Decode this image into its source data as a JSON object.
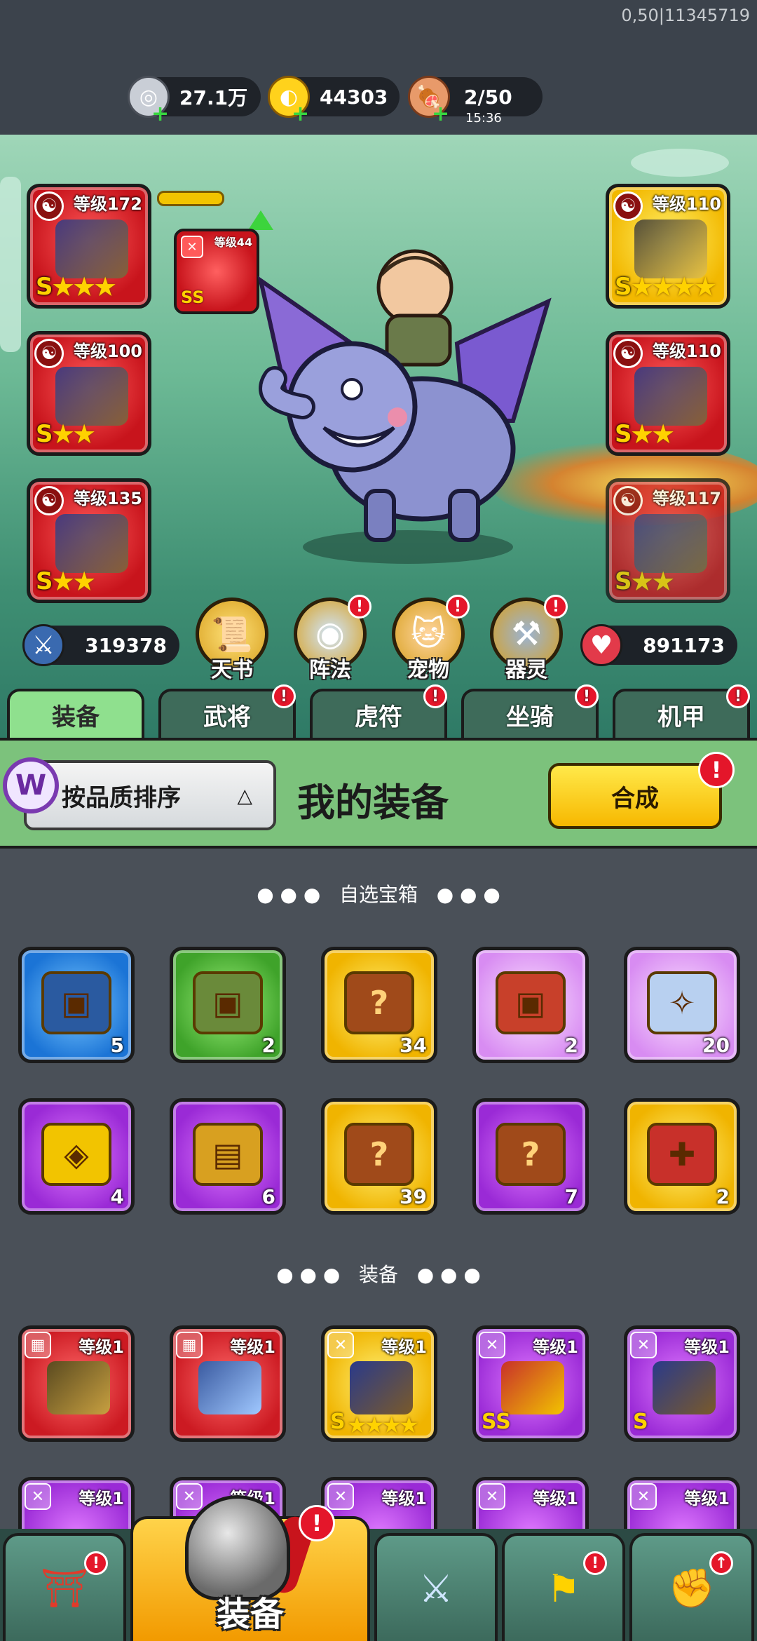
{
  "version": "0,50|11345719",
  "resources": {
    "silver": "27.1万",
    "gold": "44303",
    "stamina": "2/50",
    "stamina_timer": "15:36"
  },
  "hero": {
    "left_slots": [
      {
        "level": "等级172",
        "grade": "S",
        "stars": "★★★",
        "color": "#cc1a22"
      },
      {
        "level": "等级100",
        "grade": "S",
        "stars": "★★",
        "color": "#cc1a22"
      },
      {
        "level": "等级135",
        "grade": "S",
        "stars": "★★",
        "color": "#cc1a22"
      }
    ],
    "right_slots": [
      {
        "level": "等级110",
        "grade": "S",
        "stars": "★★★★",
        "color": "#f2b800"
      },
      {
        "level": "等级110",
        "grade": "S",
        "stars": "★★",
        "color": "#cc1a22"
      },
      {
        "level": "等级117",
        "grade": "S",
        "stars": "★★",
        "color": "#cc1a22"
      }
    ],
    "small_slot": {
      "level": "等级44",
      "grade": "SS",
      "stars": "★"
    },
    "attack": "319378",
    "hp": "891173"
  },
  "features": [
    {
      "label": "天书",
      "icon": "book-icon",
      "badge": false
    },
    {
      "label": "阵法",
      "icon": "formation-icon",
      "badge": true
    },
    {
      "label": "宠物",
      "icon": "pet-cat-icon",
      "badge": true
    },
    {
      "label": "器灵",
      "icon": "spirit-icon",
      "badge": true
    }
  ],
  "tabs": [
    {
      "label": "装备",
      "active": true,
      "badge": false
    },
    {
      "label": "武将",
      "active": false,
      "badge": true
    },
    {
      "label": "虎符",
      "active": false,
      "badge": true
    },
    {
      "label": "坐骑",
      "active": false,
      "badge": true
    },
    {
      "label": "机甲",
      "active": false,
      "badge": true
    }
  ],
  "toolbar": {
    "sort_label": "按品质排序",
    "title": "我的装备",
    "compose_label": "合成",
    "badge": "!"
  },
  "chest_section": {
    "title": "自选宝箱",
    "items": [
      {
        "count": "5",
        "color": "blue"
      },
      {
        "count": "2",
        "color": "green"
      },
      {
        "count": "34",
        "color": "gold"
      },
      {
        "count": "2",
        "color": "pink"
      },
      {
        "count": "20",
        "color": "pink"
      },
      {
        "count": "4",
        "color": "purple"
      },
      {
        "count": "6",
        "color": "purple"
      },
      {
        "count": "39",
        "color": "gold"
      },
      {
        "count": "7",
        "color": "purple"
      },
      {
        "count": "2",
        "color": "gold"
      }
    ]
  },
  "equip_section": {
    "title": "装备",
    "items": [
      {
        "level": "等级1",
        "color": "red",
        "grade": "",
        "stars": ""
      },
      {
        "level": "等级1",
        "color": "red",
        "grade": "",
        "stars": ""
      },
      {
        "level": "等级1",
        "color": "gold",
        "grade": "S",
        "stars": "★★★★"
      },
      {
        "level": "等级1",
        "color": "purple",
        "grade": "SS",
        "stars": ""
      },
      {
        "level": "等级1",
        "color": "purple",
        "grade": "S",
        "stars": ""
      },
      {
        "level": "等级1",
        "color": "purple",
        "grade": "",
        "stars": ""
      },
      {
        "level": "等级1",
        "color": "purple",
        "grade": "",
        "stars": ""
      },
      {
        "level": "等级1",
        "color": "purple",
        "grade": "",
        "stars": ""
      },
      {
        "level": "等级1",
        "color": "purple",
        "grade": "",
        "stars": ""
      },
      {
        "level": "等级1",
        "color": "purple",
        "grade": "",
        "stars": ""
      }
    ]
  },
  "bottom_nav": {
    "equip_label": "装备",
    "items": [
      {
        "icon": "shop-gate-icon",
        "badge": true
      },
      {
        "icon": "battle-shield-icon",
        "badge": false
      },
      {
        "icon": "flag-stars-icon",
        "badge": true
      },
      {
        "icon": "upgrade-fist-icon",
        "badge": true
      }
    ]
  }
}
